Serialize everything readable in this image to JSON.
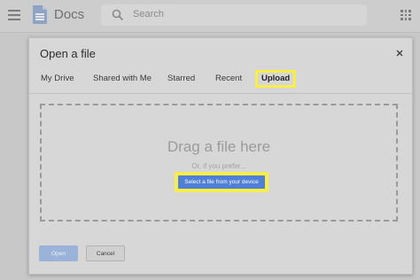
{
  "header": {
    "app_name": "Docs",
    "search_placeholder": "Search",
    "icons": {
      "menu": "hamburger-icon",
      "logo": "docs-logo-icon",
      "search": "search-icon",
      "apps": "apps-grid-icon"
    }
  },
  "dialog": {
    "title": "Open a file",
    "close_label": "×",
    "tabs": [
      {
        "label": "My Drive"
      },
      {
        "label": "Shared with Me"
      },
      {
        "label": "Starred"
      },
      {
        "label": "Recent"
      },
      {
        "label": "Upload",
        "active": true
      }
    ],
    "drop_zone": {
      "title": "Drag a file here",
      "subtitle": "Or, if you prefer...",
      "select_button_label": "Select a file from your device"
    },
    "footer": {
      "open_label": "Open",
      "cancel_label": "Cancel"
    }
  },
  "colors": {
    "accent": "#4f7fd6",
    "highlight": "#f7ee4a",
    "overlay_gray": "#c8c8c8"
  }
}
